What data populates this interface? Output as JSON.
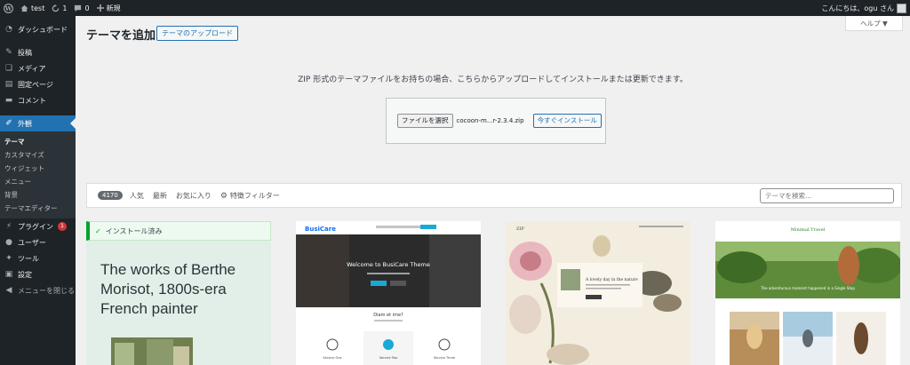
{
  "adminbar": {
    "site_name": "test",
    "updates_count": "1",
    "comments_count": "0",
    "new_label": "新規",
    "greeting": "こんにちは、ogu さん"
  },
  "sidebar": {
    "dashboard": "ダッシュボード",
    "posts": "投稿",
    "media": "メディア",
    "pages": "固定ページ",
    "comments": "コメント",
    "appearance": "外観",
    "submenu": [
      "テーマ",
      "カスタマイズ",
      "ウィジェット",
      "メニュー",
      "背景",
      "テーマエディター"
    ],
    "plugins": "プラグイン",
    "plugins_badge": "1",
    "users": "ユーザー",
    "tools": "ツール",
    "settings": "設定",
    "collapse": "メニューを閉じる"
  },
  "header": {
    "title": "テーマを追加",
    "upload_button": "テーマのアップロード",
    "help": "ヘルプ ▼"
  },
  "upload": {
    "description": "ZIP 形式のテーマファイルをお持ちの場合、こちらからアップロードしてインストールまたは更新できます。",
    "choose_file": "ファイルを選択",
    "file_name": "cocoon-m...r-2.3.4.zip",
    "install_now": "今すぐインストール"
  },
  "filter": {
    "count": "4170",
    "popular": "人気",
    "latest": "最新",
    "favorites": "お気に入り",
    "feature_filter": "特徴フィルター",
    "search_placeholder": "テーマを検索..."
  },
  "cards": {
    "installed_label": "インストール済み",
    "card1_text": "The works of Berthe Morisot, 1800s-era French painter",
    "card2_brand": "BusiCare",
    "card2_headline": "Welcome to BusiCare Theme",
    "card2_tagline": "Diam et ime?",
    "card2_features": [
      "Service One",
      "Service Two",
      "Service Three"
    ],
    "card3_brand": "ZIP",
    "card3_headline": "A lovely day in the nature",
    "card4_brand": "Minimal Travel",
    "card4_caption": "The adventurous moment happened in a Single Stop"
  },
  "colors": {
    "admin_dark": "#1d2327",
    "accent_blue": "#2271b1",
    "installed_green": "#00a32a"
  }
}
